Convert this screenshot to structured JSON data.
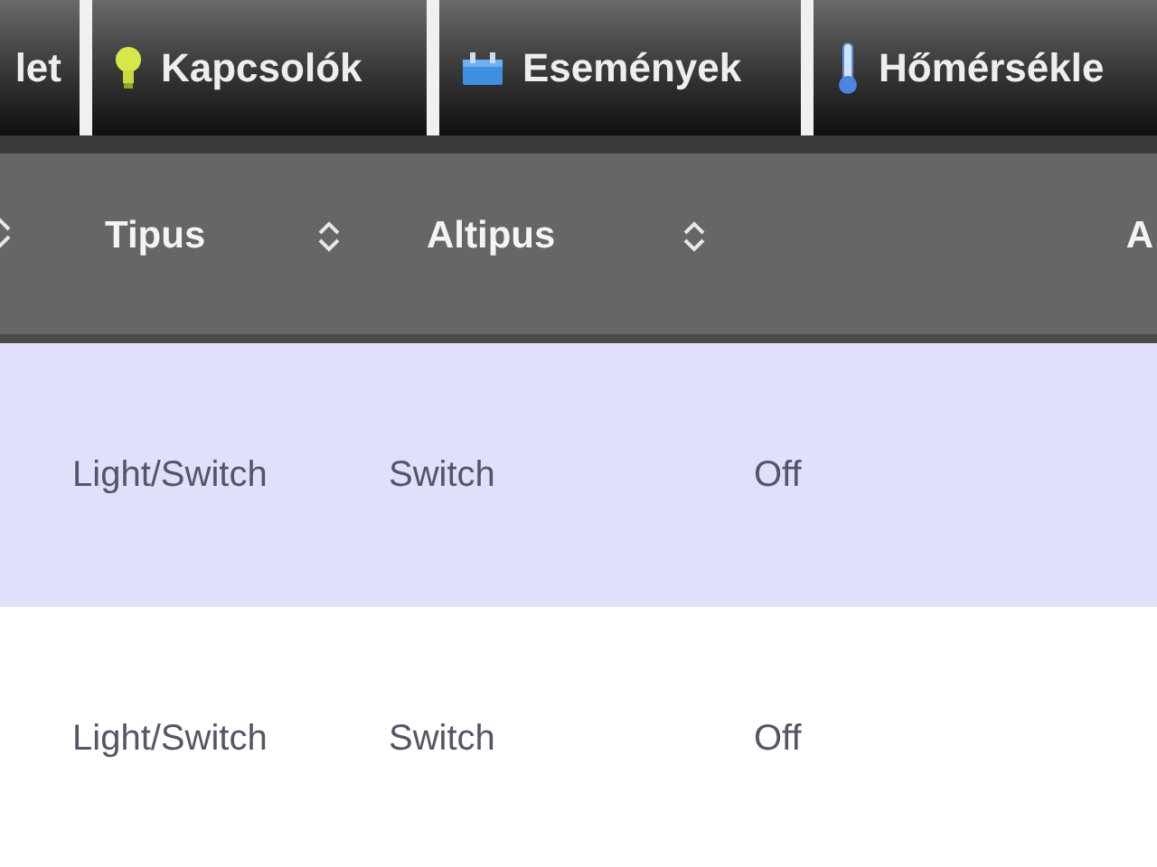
{
  "tabs": [
    {
      "label": "let",
      "selected": false
    },
    {
      "label": "Kapcsolók",
      "selected": false
    },
    {
      "label": "Események",
      "selected": false
    },
    {
      "label": "Hőmérsékle",
      "selected": false
    }
  ],
  "table": {
    "columns": [
      "Tipus",
      "Altipus"
    ],
    "cut_column_header": "A",
    "rows": [
      {
        "selected": true,
        "cells": [
          "Light/Switch",
          "Switch",
          "Off"
        ]
      },
      {
        "selected": false,
        "cells": [
          "Light/Switch",
          "Switch",
          "Off"
        ]
      }
    ]
  }
}
